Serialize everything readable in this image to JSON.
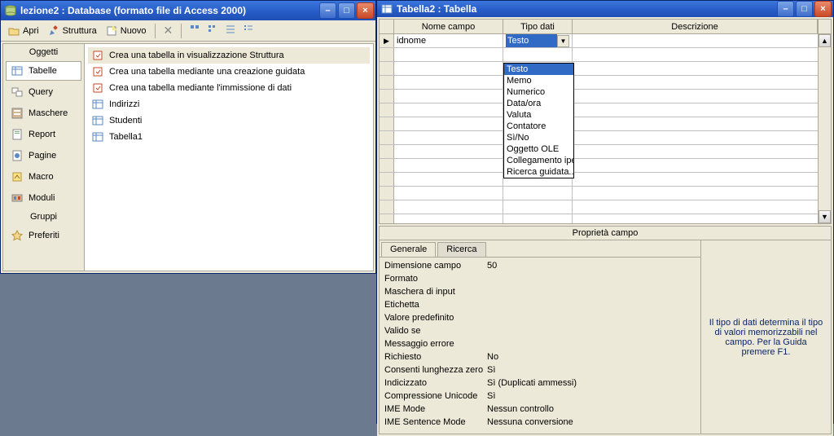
{
  "dbWindow": {
    "title": "lezione2 : Database (formato file di Access 2000)",
    "toolbar": {
      "open": "Apri",
      "design": "Struttura",
      "new": "Nuovo"
    },
    "sideGroups": {
      "objects": "Oggetti",
      "groups": "Gruppi"
    },
    "sideItems": {
      "tables": "Tabelle",
      "queries": "Query",
      "forms": "Maschere",
      "reports": "Report",
      "pages": "Pagine",
      "macros": "Macro",
      "modules": "Moduli",
      "favorites": "Preferiti"
    },
    "listItems": {
      "createDesign": "Crea una tabella in visualizzazione Struttura",
      "createWizard": "Crea una tabella mediante una creazione guidata",
      "createEntry": "Crea una tabella mediante l'immissione di dati",
      "t1": "Indirizzi",
      "t2": "Studenti",
      "t3": "Tabella1"
    }
  },
  "tblWindow": {
    "title": "Tabella2 : Tabella",
    "colHeaders": {
      "name": "Nome campo",
      "type": "Tipo dati",
      "desc": "Descrizione"
    },
    "row1": {
      "name": "idnome",
      "type": "Testo"
    },
    "typeOptions": {
      "o1": "Testo",
      "o2": "Memo",
      "o3": "Numerico",
      "o4": "Data/ora",
      "o5": "Valuta",
      "o6": "Contatore",
      "o7": "Sì/No",
      "o8": "Oggetto OLE",
      "o9": "Collegamento ipert",
      "o10": "Ricerca guidata..."
    },
    "propPaneTitle": "Proprietà campo",
    "tabs": {
      "general": "Generale",
      "lookup": "Ricerca"
    },
    "props": {
      "p1l": "Dimensione campo",
      "p1v": "50",
      "p2l": "Formato",
      "p2v": "",
      "p3l": "Maschera di input",
      "p3v": "",
      "p4l": "Etichetta",
      "p4v": "",
      "p5l": "Valore predefinito",
      "p5v": "",
      "p6l": "Valido se",
      "p6v": "",
      "p7l": "Messaggio errore",
      "p7v": "",
      "p8l": "Richiesto",
      "p8v": "No",
      "p9l": "Consenti lunghezza zero",
      "p9v": "Sì",
      "p10l": "Indicizzato",
      "p10v": "Sì (Duplicati ammessi)",
      "p11l": "Compressione Unicode",
      "p11v": "Sì",
      "p12l": "IME Mode",
      "p12v": "Nessun controllo",
      "p13l": "IME Sentence Mode",
      "p13v": "Nessuna conversione"
    },
    "helpText": "Il tipo di dati determina il tipo di valori memorizzabili nel campo. Per la Guida premere F1."
  }
}
